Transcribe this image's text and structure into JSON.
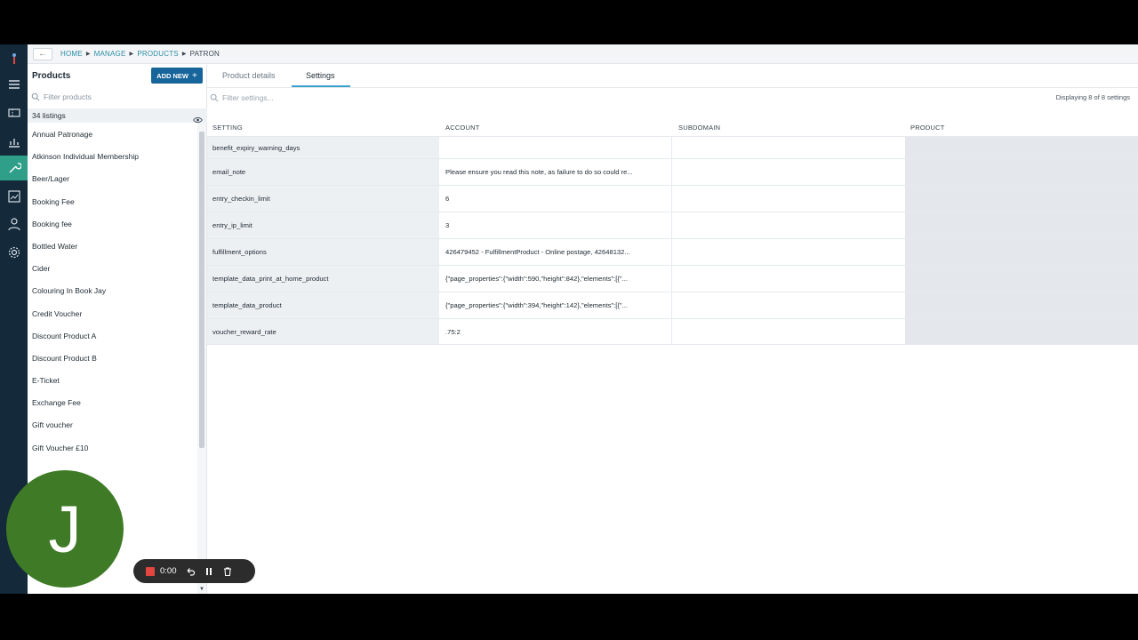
{
  "breadcrumbs": [
    "HOME",
    "MANAGE",
    "PRODUCTS",
    "PATRON"
  ],
  "panel": {
    "title": "Products",
    "add_new_label": "ADD NEW",
    "filter_placeholder": "Filter products",
    "listings_count": "34 listings",
    "items": [
      "Annual Patronage",
      "Atkinson Individual Membership",
      "Beer/Lager",
      "Booking Fee",
      "Booking fee",
      "Bottled Water",
      "Cider",
      "Colouring In Book Jay",
      "Credit Voucher",
      "Discount Product A",
      "Discount Product B",
      "E-Ticket",
      "Exchange Fee",
      "Gift voucher",
      "Gift Voucher £10"
    ]
  },
  "tabs": {
    "product_details": "Product details",
    "settings": "Settings"
  },
  "settings": {
    "filter_placeholder": "Filter settings...",
    "displaying": "Displaying 8 of 8 settings",
    "columns": [
      "SETTING",
      "ACCOUNT",
      "SUBDOMAIN",
      "PRODUCT"
    ],
    "rows": [
      {
        "setting": "benefit_expiry_warning_days",
        "account": "",
        "subdomain": "",
        "product": ""
      },
      {
        "setting": "email_note",
        "account": "Please ensure you read this note, as failure to do so could re...",
        "subdomain": "",
        "product": ""
      },
      {
        "setting": "entry_checkin_limit",
        "account": "6",
        "subdomain": "",
        "product": ""
      },
      {
        "setting": "entry_ip_limit",
        "account": "3",
        "subdomain": "",
        "product": ""
      },
      {
        "setting": "fulfillment_options",
        "account": "426479452 - FulfillmentProduct - Online postage, 42648132...",
        "subdomain": "",
        "product": ""
      },
      {
        "setting": "template_data_print_at_home_product",
        "account": "{\"page_properties\":{\"width\":590,\"height\":842},\"elements\":[{\"...",
        "subdomain": "",
        "product": ""
      },
      {
        "setting": "template_data_product",
        "account": "{\"page_properties\":{\"width\":394,\"height\":142},\"elements\":[{\"...",
        "subdomain": "",
        "product": ""
      },
      {
        "setting": "voucher_reward_rate",
        "account": ".75:2",
        "subdomain": "",
        "product": ""
      }
    ]
  },
  "recorder": {
    "avatar_initial": "J",
    "time": "0:00",
    "stop_color": "#e2463f"
  },
  "colors": {
    "rail": "#142a3b",
    "rail_active": "#2f9f8a",
    "accent": "#17659a",
    "tab_underline": "#3aa6d0",
    "avatar": "#3f7b26"
  }
}
